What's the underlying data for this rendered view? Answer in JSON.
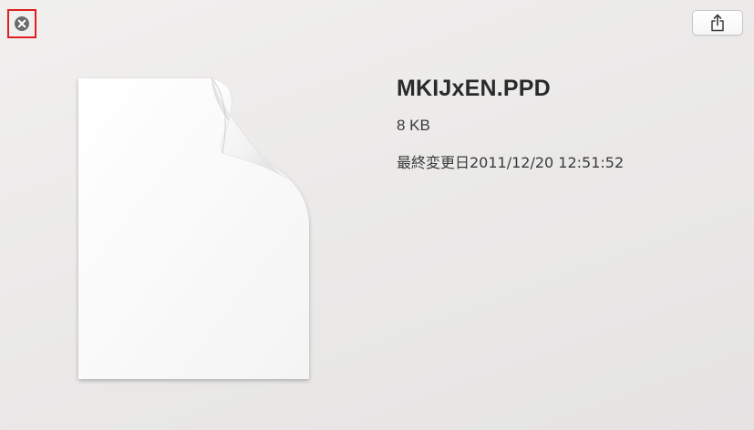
{
  "window": {
    "title": "MKIJxEN.PPD"
  },
  "toolbar": {
    "close_icon": "close-circle-icon",
    "share_icon": "share-icon"
  },
  "document": {
    "icon": "generic-document-icon"
  },
  "info": {
    "file_name": "MKIJxEN.PPD",
    "file_size": "8 KB",
    "modified": "最終変更日2011/12/20 12:51:52"
  },
  "colors": {
    "background": "#ebeae9",
    "close_highlight": "#e02020",
    "close_icon": "#6b6b6b",
    "text": "#2b2b2b"
  }
}
